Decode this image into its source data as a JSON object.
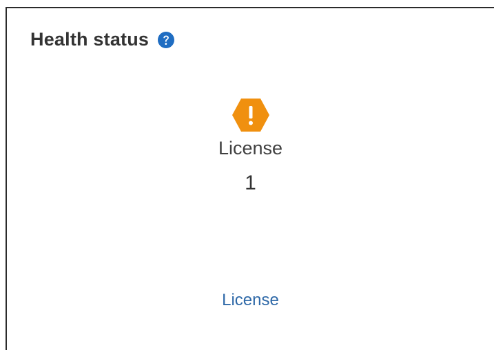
{
  "panel": {
    "title": "Health status",
    "help_icon": "question-circle-icon",
    "status": {
      "icon": "warning-hexagon-icon",
      "label": "License",
      "count": "1"
    },
    "link_text": "License"
  },
  "colors": {
    "warning": "#f0900f",
    "help": "#1f6dc2",
    "link": "#2f69a8"
  }
}
